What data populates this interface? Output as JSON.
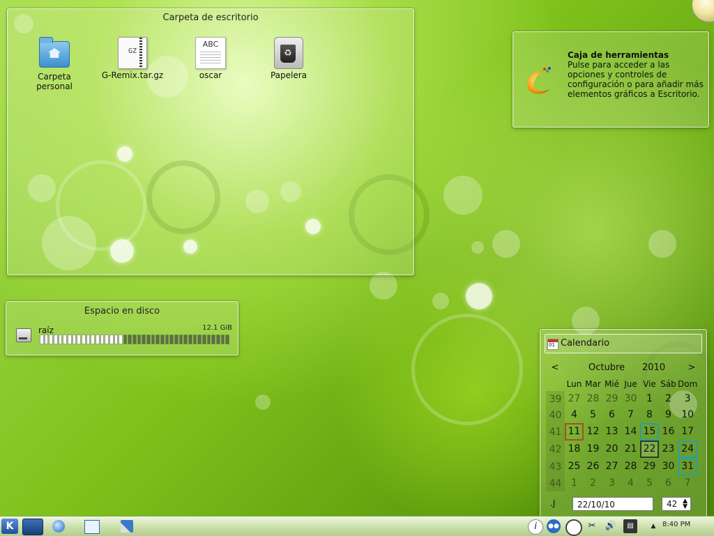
{
  "folder_view": {
    "title": "Carpeta de escritorio",
    "icons": [
      {
        "label": "Carpeta\npersonal",
        "icon": "home-folder-icon"
      },
      {
        "label": "G-Remix.tar.gz",
        "icon": "archive-icon",
        "badge": "GZ"
      },
      {
        "label": "oscar",
        "icon": "text-file-icon",
        "badge": "ABC"
      },
      {
        "label": "Papelera",
        "icon": "trash-icon"
      }
    ]
  },
  "toolbox": {
    "title": "Caja de herramientas",
    "description": "Pulse para acceder a las opciones y controles de configuración o para añadir más elementos gráficos a Escritorio."
  },
  "disk": {
    "title": "Espacio en disco",
    "label": "raíz",
    "size": "12.1 GiB",
    "used_fraction": 0.44
  },
  "calendar": {
    "title": "Calendario",
    "month": "Octubre",
    "year": "2010",
    "prev": "<",
    "next": ">",
    "weekdays": [
      "Lun",
      "Mar",
      "Mié",
      "Jue",
      "Vie",
      "Sáb",
      "Dom"
    ],
    "weeks": [
      {
        "num": "39",
        "days": [
          "27",
          "28",
          "29",
          "30",
          "1",
          "2",
          "3"
        ],
        "other": [
          0,
          1,
          2,
          3
        ]
      },
      {
        "num": "40",
        "days": [
          "4",
          "5",
          "6",
          "7",
          "8",
          "9",
          "10"
        ],
        "other": []
      },
      {
        "num": "41",
        "days": [
          "11",
          "12",
          "13",
          "14",
          "15",
          "16",
          "17"
        ],
        "other": []
      },
      {
        "num": "42",
        "days": [
          "18",
          "19",
          "20",
          "21",
          "22",
          "23",
          "24"
        ],
        "other": []
      },
      {
        "num": "43",
        "days": [
          "25",
          "26",
          "27",
          "28",
          "29",
          "30",
          "31"
        ],
        "other": []
      },
      {
        "num": "44",
        "days": [
          "1",
          "2",
          "3",
          "4",
          "5",
          "6",
          "7"
        ],
        "other": [
          0,
          1,
          2,
          3,
          4,
          5,
          6
        ]
      }
    ],
    "highlight_red": [
      "11"
    ],
    "highlight_teal": [
      "15",
      "24",
      "31"
    ],
    "today": "22",
    "date_value": "22/10/10",
    "week_value": "42",
    "jump_label": ".J"
  },
  "taskbar": {
    "kickoff_label": "K",
    "clock": "8:40 PM"
  }
}
